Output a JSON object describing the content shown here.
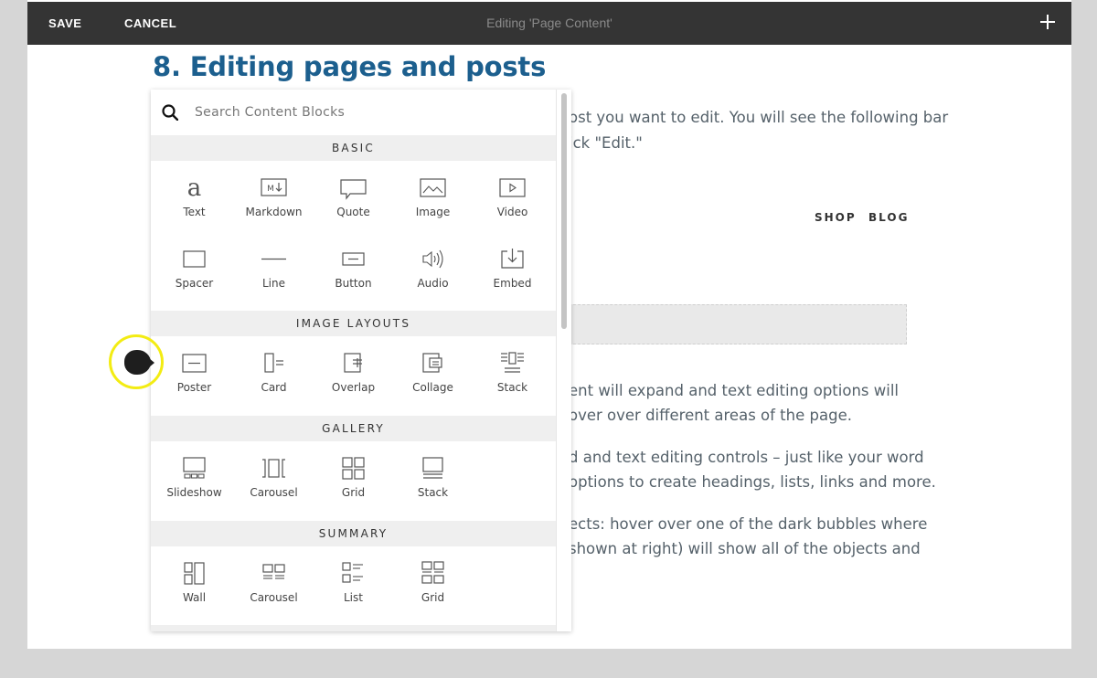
{
  "toolbar": {
    "save_label": "SAVE",
    "cancel_label": "CANCEL",
    "title": "Editing 'Page Content'",
    "add_icon": "plus-icon"
  },
  "page": {
    "heading": "8. Editing pages and posts",
    "para1_line1": "ost you want to edit. You will see the following bar",
    "para1_line2": "ick \"Edit.\"",
    "nav_shop": "SHOP",
    "nav_blog": "BLOG",
    "para2_line1": "ent will expand and text editing options will",
    "para2_line2": "over over different areas of the page.",
    "para3_line1": "d and text editing controls – just like your word",
    "para3_line2": "options to create headings, lists, links and more.",
    "para4_line1": "ects: hover over one of the dark bubbles where",
    "para4_line2": "shown at right) will show all of the objects and"
  },
  "panel": {
    "search_placeholder": "Search Content Blocks",
    "sections": {
      "basic": "BASIC",
      "image_layouts": "IMAGE LAYOUTS",
      "gallery": "GALLERY",
      "summary": "SUMMARY"
    },
    "basic": {
      "text": "Text",
      "markdown": "Markdown",
      "quote": "Quote",
      "image": "Image",
      "video": "Video",
      "spacer": "Spacer",
      "line": "Line",
      "button": "Button",
      "audio": "Audio",
      "embed": "Embed"
    },
    "image_layouts": {
      "poster": "Poster",
      "card": "Card",
      "overlap": "Overlap",
      "collage": "Collage",
      "stack": "Stack"
    },
    "gallery": {
      "slideshow": "Slideshow",
      "carousel": "Carousel",
      "grid": "Grid",
      "stack": "Stack"
    },
    "summary": {
      "wall": "Wall",
      "carousel": "Carousel",
      "list": "List",
      "grid": "Grid"
    }
  },
  "colors": {
    "toolbar_bg": "#343434",
    "heading": "#1c5f8e",
    "cursor_highlight": "#f3ec13"
  }
}
